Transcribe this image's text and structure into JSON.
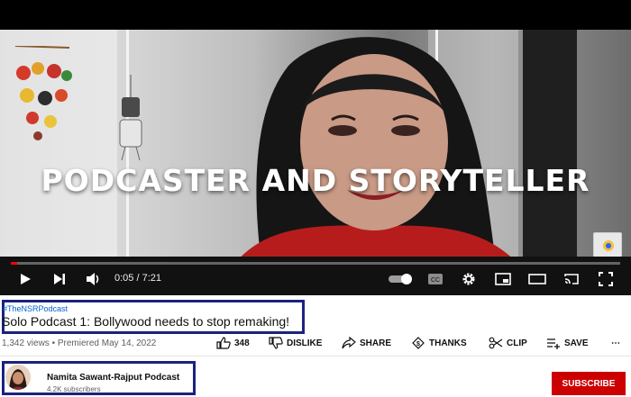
{
  "player": {
    "overlay_title": "PODCASTER AND STORYTELLER",
    "current_time": "0:05",
    "duration": "7:21",
    "time_display": "0:05 / 7:21",
    "progress_fraction": 0.011,
    "cc_label": "CC",
    "icons": [
      "play-icon",
      "next-icon",
      "volume-icon",
      "autoplay-toggle",
      "captions-icon",
      "settings-icon",
      "miniplayer-icon",
      "theater-icon",
      "cast-icon",
      "fullscreen-icon"
    ],
    "accent_color": "#ff0000"
  },
  "video": {
    "hashtag": "#TheNSRPodcast",
    "title": "Solo Podcast 1: Bollywood needs to stop remaking!",
    "meta": "1,342 views • Premiered May 14, 2022"
  },
  "actions": {
    "like_count": "348",
    "dislike_label": "DISLIKE",
    "share_label": "SHARE",
    "thanks_label": "THANKS",
    "clip_label": "CLIP",
    "save_label": "SAVE",
    "more_label": "⋯"
  },
  "channel": {
    "name": "Namita Sawant-Rajput Podcast",
    "subscribers": "4.2K subscribers",
    "subscribe_label": "SUBSCRIBE",
    "subscribe_color": "#cc0000"
  },
  "highlight_color": "#1a237e"
}
